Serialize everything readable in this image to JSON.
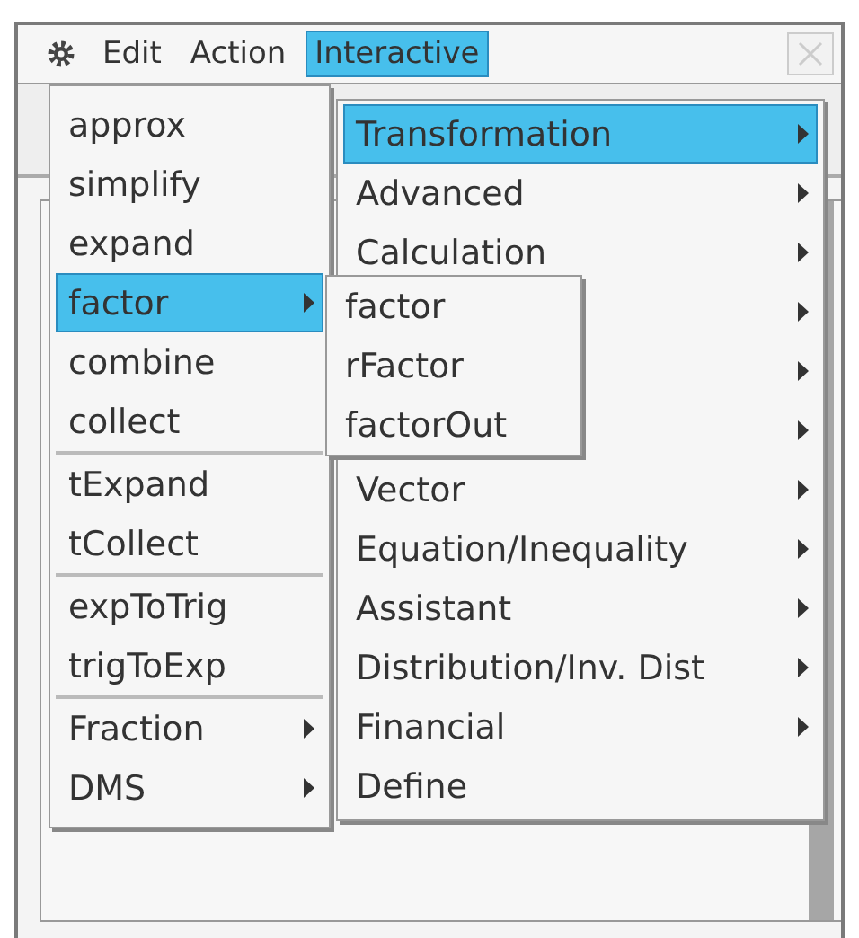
{
  "menubar": {
    "menus": [
      {
        "label": "Edit",
        "selected": false
      },
      {
        "label": "Action",
        "selected": false
      },
      {
        "label": "Interactive",
        "selected": true
      }
    ]
  },
  "action_menu": {
    "groups": [
      [
        {
          "label": "approx",
          "submenu": false,
          "selected": false
        },
        {
          "label": "simplify",
          "submenu": false,
          "selected": false
        },
        {
          "label": "expand",
          "submenu": false,
          "selected": false
        },
        {
          "label": "factor",
          "submenu": true,
          "selected": true
        },
        {
          "label": "combine",
          "submenu": false,
          "selected": false
        },
        {
          "label": "collect",
          "submenu": false,
          "selected": false
        }
      ],
      [
        {
          "label": "tExpand",
          "submenu": false,
          "selected": false
        },
        {
          "label": "tCollect",
          "submenu": false,
          "selected": false
        }
      ],
      [
        {
          "label": "expToTrig",
          "submenu": false,
          "selected": false
        },
        {
          "label": "trigToExp",
          "submenu": false,
          "selected": false
        }
      ],
      [
        {
          "label": "Fraction",
          "submenu": true,
          "selected": false
        },
        {
          "label": "DMS",
          "submenu": true,
          "selected": false
        }
      ]
    ]
  },
  "interactive_menu": {
    "items": [
      {
        "label": "Transformation",
        "submenu": true,
        "selected": true
      },
      {
        "label": "Advanced",
        "submenu": true,
        "selected": false
      },
      {
        "label": "Calculation",
        "submenu": true,
        "selected": false
      },
      {
        "submenu": true
      },
      {
        "submenu": true
      },
      {
        "submenu": true
      },
      {
        "label": "Vector",
        "submenu": true,
        "selected": false
      },
      {
        "label": "Equation/Inequality",
        "submenu": true,
        "selected": false
      },
      {
        "label": "Assistant",
        "submenu": true,
        "selected": false
      },
      {
        "label": "Distribution/Inv. Dist",
        "submenu": true,
        "selected": false
      },
      {
        "label": "Financial",
        "submenu": true,
        "selected": false
      },
      {
        "label": "Define",
        "submenu": false,
        "selected": false
      }
    ]
  },
  "factor_submenu": {
    "items": [
      {
        "label": "factor",
        "selected": false
      },
      {
        "label": "rFactor",
        "selected": false
      },
      {
        "label": "factorOut",
        "selected": false
      }
    ]
  }
}
